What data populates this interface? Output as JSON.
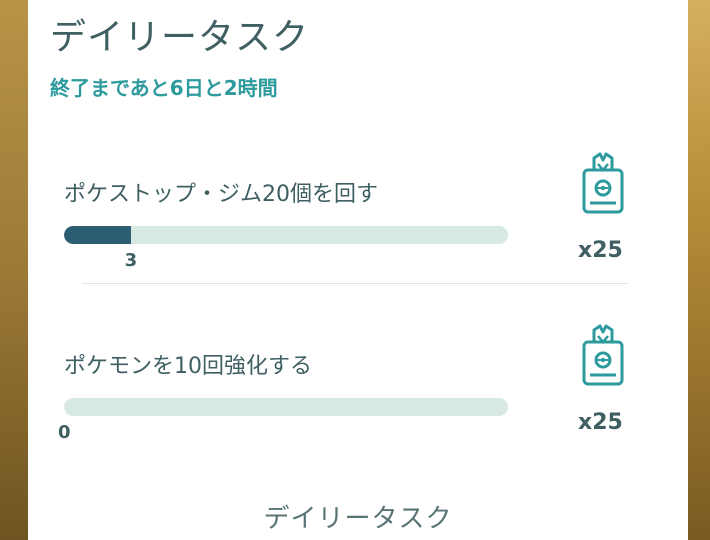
{
  "header": {
    "title": "デイリータスク",
    "remaining": "終了まであと6日と2時間"
  },
  "tasks": [
    {
      "label": "ポケストップ・ジム20個を回す",
      "progress_value": 3,
      "progress_fraction": 0.15,
      "progress_text": "3",
      "reward_icon": "pass-icon",
      "reward_qty": "x25"
    },
    {
      "label": "ポケモンを10回強化する",
      "progress_value": 0,
      "progress_fraction": 0,
      "progress_text": "0",
      "reward_icon": "pass-icon",
      "reward_qty": "x25"
    }
  ],
  "footer": {
    "label": "デイリータスク"
  },
  "colors": {
    "accent": "#2d9a9d",
    "text": "#3f5f63",
    "progress_fill": "#2d5d73",
    "progress_track": "#d8e8e2",
    "border_gold": "#c9a24a"
  }
}
